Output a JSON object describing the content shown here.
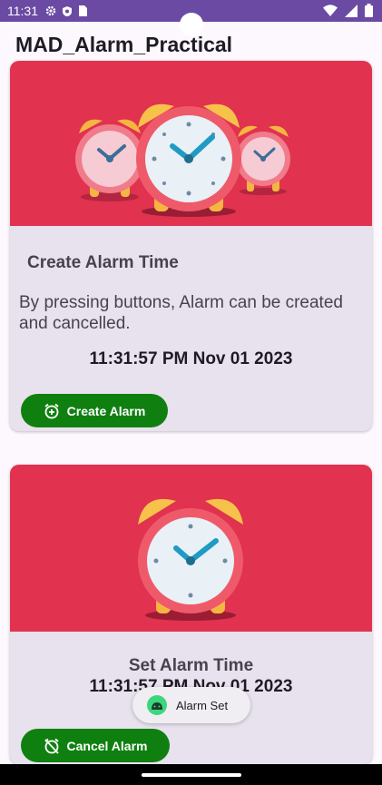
{
  "status_bar": {
    "time": "11:31"
  },
  "app": {
    "title": "MAD_Alarm_Practical"
  },
  "card_create": {
    "heading": "Create Alarm Time",
    "description": "By pressing buttons, Alarm can be created and cancelled.",
    "datetime": "11:31:57 PM Nov 01 2023",
    "button_label": "Create Alarm"
  },
  "card_cancel": {
    "heading": "Set Alarm Time",
    "datetime": "11:31:57 PM Nov 01 2023",
    "button_label": "Cancel Alarm"
  },
  "toast": {
    "message": "Alarm Set"
  },
  "colors": {
    "status_bar": "#6a4aa3",
    "card_image_bg": "#e1324f",
    "button": "#0f8010",
    "card_bg": "#e8e2ee"
  }
}
